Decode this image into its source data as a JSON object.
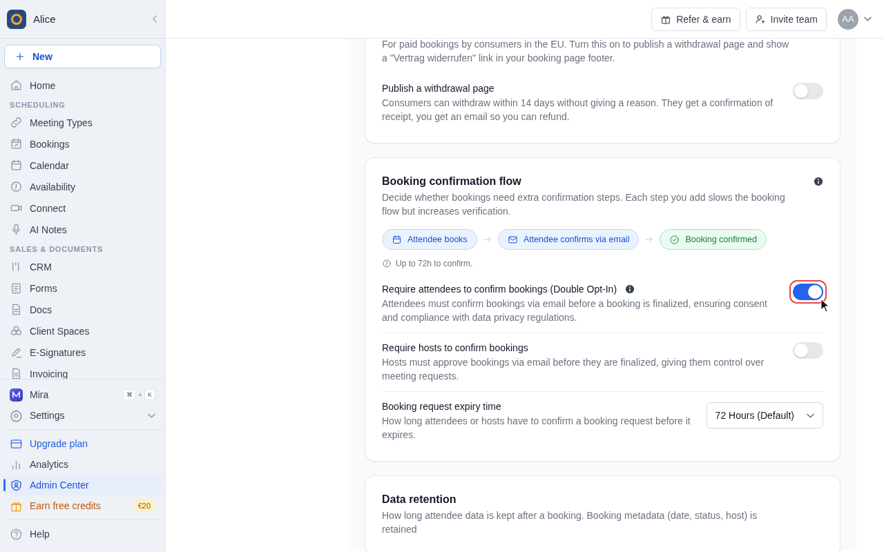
{
  "sidebar": {
    "workspace": "Alice",
    "new_button": "New",
    "nav": [
      {
        "kind": "item",
        "label": "Home",
        "selected": false
      },
      {
        "kind": "heading",
        "label": "SCHEDULING"
      },
      {
        "kind": "item",
        "label": "Meeting Types",
        "selected": false
      },
      {
        "kind": "item",
        "label": "Bookings",
        "selected": false
      },
      {
        "kind": "item",
        "label": "Calendar",
        "selected": false
      },
      {
        "kind": "item",
        "label": "Availability",
        "selected": false
      },
      {
        "kind": "item",
        "label": "Connect",
        "selected": false
      },
      {
        "kind": "item",
        "label": "AI Notes",
        "selected": false
      },
      {
        "kind": "heading",
        "label": "SALES & DOCUMENTS"
      },
      {
        "kind": "item",
        "label": "CRM",
        "selected": false
      },
      {
        "kind": "item",
        "label": "Forms",
        "selected": false
      },
      {
        "kind": "item",
        "label": "Docs",
        "selected": false
      },
      {
        "kind": "item",
        "label": "Client Spaces",
        "selected": false
      },
      {
        "kind": "item",
        "label": "E-Signatures",
        "selected": false
      },
      {
        "kind": "item",
        "label": "Invoicing",
        "selected": false
      }
    ],
    "assistant": {
      "label": "Mira",
      "shortcut": [
        "⌘",
        "+",
        "K"
      ]
    },
    "settings": {
      "label": "Settings",
      "expanded": false
    },
    "bottom": [
      {
        "kind": "upgrade",
        "label": "Upgrade plan",
        "selected": false
      },
      {
        "kind": "item",
        "label": "Analytics",
        "selected": false
      },
      {
        "kind": "item",
        "label": "Admin Center",
        "selected": true
      },
      {
        "kind": "credits",
        "label": "Earn free credits",
        "badge": "€20",
        "selected": false
      }
    ],
    "help": "Help"
  },
  "header": {
    "buttons": [
      "Refer & earn",
      "Invite team"
    ],
    "avatar": "AA"
  },
  "cards": [
    {
      "intro": "For paid bookings by consumers in the EU. Turn this on to publish a withdrawal page and show a \"Vertrag widerrufen\" link in your booking page footer.",
      "rows": [
        {
          "kind": "toggle",
          "label": "Publish a withdrawal page",
          "description": "Consumers can withdraw within 14 days without giving a reason. They get a confirmation of receipt, you get an email so you can refund.",
          "on": false,
          "focused": false
        }
      ]
    },
    {
      "title": "Booking confirmation flow",
      "info": true,
      "description": "Decide whether bookings need extra confirmation steps. Each step you add slows the booking flow but increases verification.",
      "flow": [
        {
          "kind": "calendar",
          "label": "Attendee books",
          "done": false
        },
        {
          "kind": "mail",
          "label": "Attendee confirms via email",
          "done": false
        },
        {
          "kind": "check",
          "label": "Booking confirmed",
          "done": true
        }
      ],
      "note": "Up to 72h to confirm.",
      "rows": [
        {
          "kind": "toggle",
          "label": "Require attendees to confirm bookings (Double Opt-In)",
          "description": "Attendees must confirm bookings via email before a booking is finalized, ensuring consent and compliance with data privacy regulations.",
          "on": true,
          "focused": true,
          "info": true
        },
        {
          "kind": "toggle",
          "label": "Require hosts to confirm bookings",
          "description": "Hosts must approve bookings via email before they are finalized, giving them control over meeting requests.",
          "on": false,
          "focused": false
        },
        {
          "kind": "select",
          "label": "Booking request expiry time",
          "description": "How long attendees or hosts have to confirm a booking request before it expires.",
          "value": "72 Hours (Default)"
        }
      ]
    },
    {
      "title": "Data retention",
      "description": "How long attendee data is kept after a booking. Booking metadata (date, status, host) is retained"
    }
  ]
}
